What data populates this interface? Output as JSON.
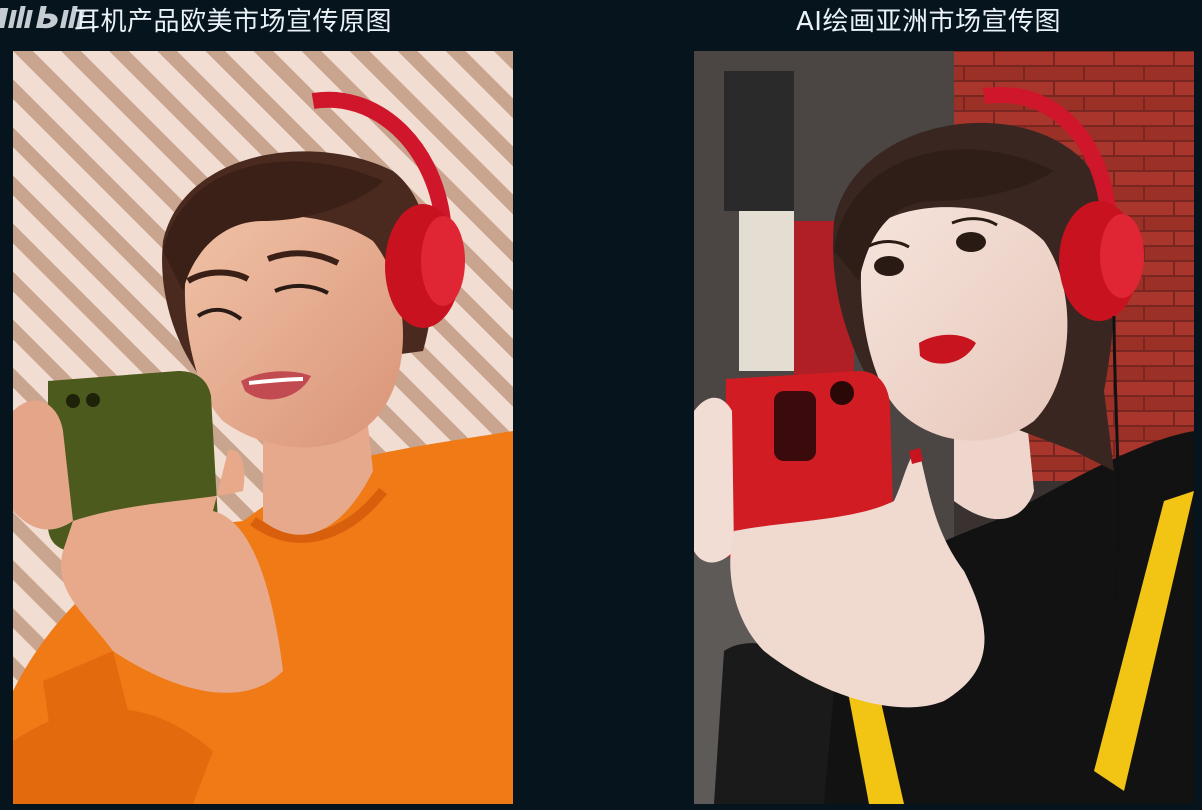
{
  "watermark": {
    "text": "bilibili",
    "icon": "bilibili-logo-icon"
  },
  "panels": [
    {
      "title": "耳机产品欧美市场宣传原图",
      "image": "woman-orange-sweater-red-headphones-photo"
    },
    {
      "title": "AI绘画亚洲市场宣传图",
      "image": "ai-woman-black-hoodie-red-headphones-image"
    }
  ],
  "colors": {
    "background": "#06141d",
    "title_text": "#eaf2f7",
    "headphones_red": "#d0162a",
    "sweater_orange": "#f07a16",
    "hoodie_black": "#121212",
    "strap_yellow": "#f2c414"
  }
}
